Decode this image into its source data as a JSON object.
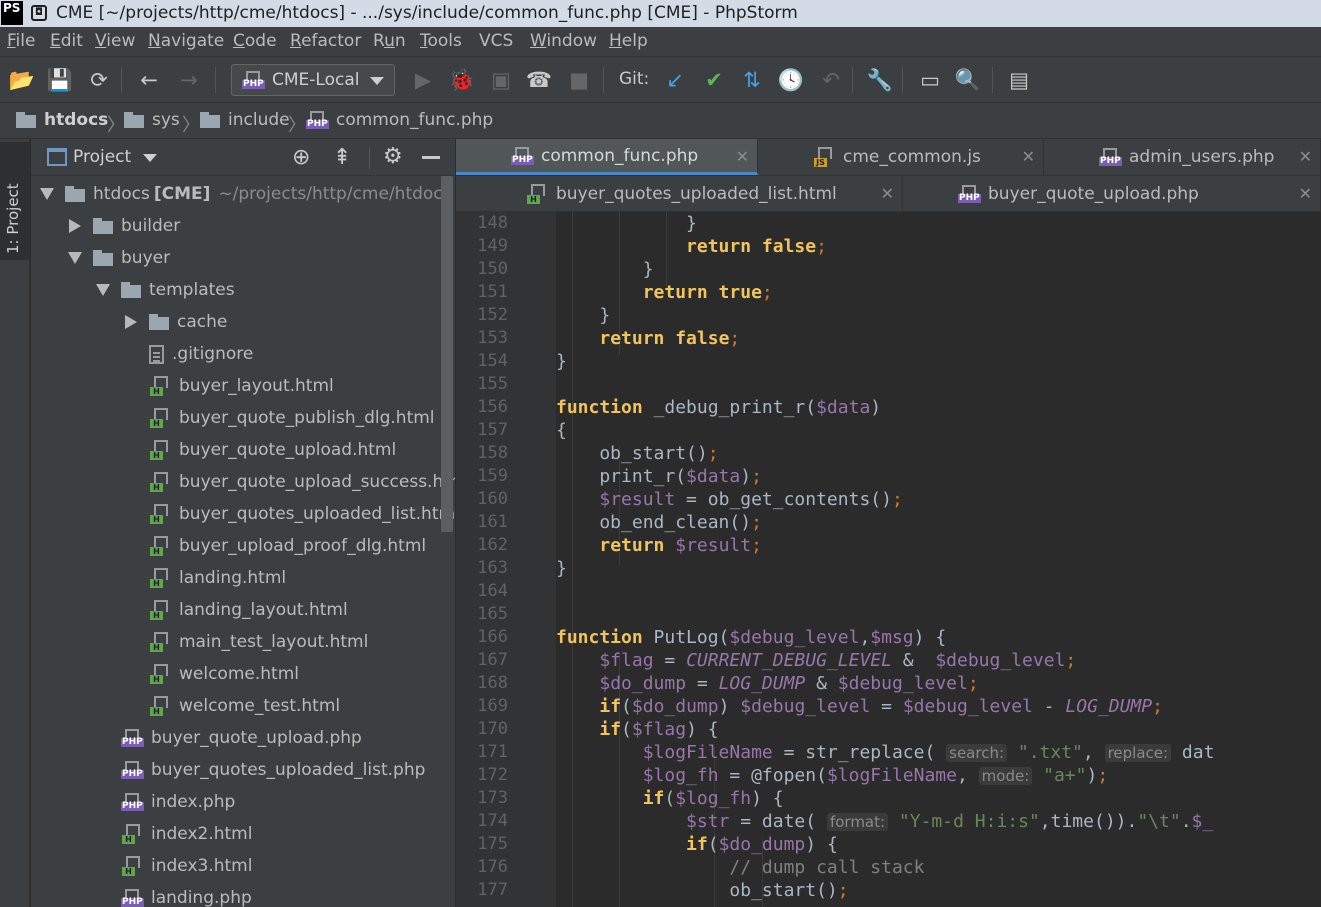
{
  "window": {
    "title": "CME [~/projects/http/cme/htdocs] - .../sys/include/common_func.php [CME] - PhpStorm",
    "app_badge": "PS"
  },
  "menu": [
    "File",
    "Edit",
    "View",
    "Navigate",
    "Code",
    "Refactor",
    "Run",
    "Tools",
    "VCS",
    "Window",
    "Help"
  ],
  "menu_mnemonics": [
    "F",
    "E",
    "V",
    "N",
    "C",
    "R",
    "u",
    "T",
    "",
    "W",
    "H"
  ],
  "toolbar": {
    "run_config": "CME-Local",
    "git_label": "Git:"
  },
  "breadcrumb": [
    "htdocs",
    "sys",
    "include",
    "common_func.php"
  ],
  "left_strip": {
    "project_tab": "1: Project"
  },
  "project_panel": {
    "title": "Project",
    "tree": [
      {
        "label": "htdocs",
        "bold": "[CME]",
        "path": "~/projects/http/cme/htdocs",
        "type": "folder",
        "depth": 0,
        "state": "open"
      },
      {
        "label": "builder",
        "type": "folder",
        "depth": 1,
        "state": "closed"
      },
      {
        "label": "buyer",
        "type": "folder",
        "depth": 1,
        "state": "open"
      },
      {
        "label": "templates",
        "type": "folder",
        "depth": 2,
        "state": "open"
      },
      {
        "label": "cache",
        "type": "folder",
        "depth": 3,
        "state": "closed"
      },
      {
        "label": ".gitignore",
        "type": "file",
        "depth": 3
      },
      {
        "label": "buyer_layout.html",
        "type": "html",
        "depth": 3
      },
      {
        "label": "buyer_quote_publish_dlg.html",
        "type": "html",
        "depth": 3
      },
      {
        "label": "buyer_quote_upload.html",
        "type": "html",
        "depth": 3
      },
      {
        "label": "buyer_quote_upload_success.html",
        "type": "html",
        "depth": 3
      },
      {
        "label": "buyer_quotes_uploaded_list.html",
        "type": "html",
        "depth": 3
      },
      {
        "label": "buyer_upload_proof_dlg.html",
        "type": "html",
        "depth": 3
      },
      {
        "label": "landing.html",
        "type": "html",
        "depth": 3
      },
      {
        "label": "landing_layout.html",
        "type": "html",
        "depth": 3
      },
      {
        "label": "main_test_layout.html",
        "type": "html",
        "depth": 3
      },
      {
        "label": "welcome.html",
        "type": "html",
        "depth": 3
      },
      {
        "label": "welcome_test.html",
        "type": "html",
        "depth": 3
      },
      {
        "label": "buyer_quote_upload.php",
        "type": "php",
        "depth": 2
      },
      {
        "label": "buyer_quotes_uploaded_list.php",
        "type": "php",
        "depth": 2
      },
      {
        "label": "index.php",
        "type": "php",
        "depth": 2
      },
      {
        "label": "index2.html",
        "type": "html",
        "depth": 2
      },
      {
        "label": "index3.html",
        "type": "html",
        "depth": 2
      },
      {
        "label": "landing.php",
        "type": "php",
        "depth": 2
      }
    ]
  },
  "editor_tabs_row1": [
    {
      "label": "common_func.php",
      "type": "php",
      "active": true
    },
    {
      "label": "cme_common.js",
      "type": "js",
      "active": false
    },
    {
      "label": "admin_users.php",
      "type": "php",
      "active": false
    }
  ],
  "editor_tabs_row2": [
    {
      "label": "buyer_quotes_uploaded_list.html",
      "type": "html",
      "active": false
    },
    {
      "label": "buyer_quote_upload.php",
      "type": "php",
      "active": false
    }
  ],
  "code": {
    "line_numbers": [
      "148",
      "149",
      "150",
      "151",
      "152",
      "153",
      "154",
      "155",
      "156",
      "157",
      "158",
      "159",
      "160",
      "161",
      "162",
      "163",
      "164",
      "165",
      "166",
      "167",
      "168",
      "169",
      "170",
      "171",
      "172",
      "173",
      "174",
      "175",
      "176",
      "177"
    ],
    "hints": {
      "search": "search:",
      "replace": "replace:",
      "mode": "mode:",
      "format": "format:"
    }
  }
}
